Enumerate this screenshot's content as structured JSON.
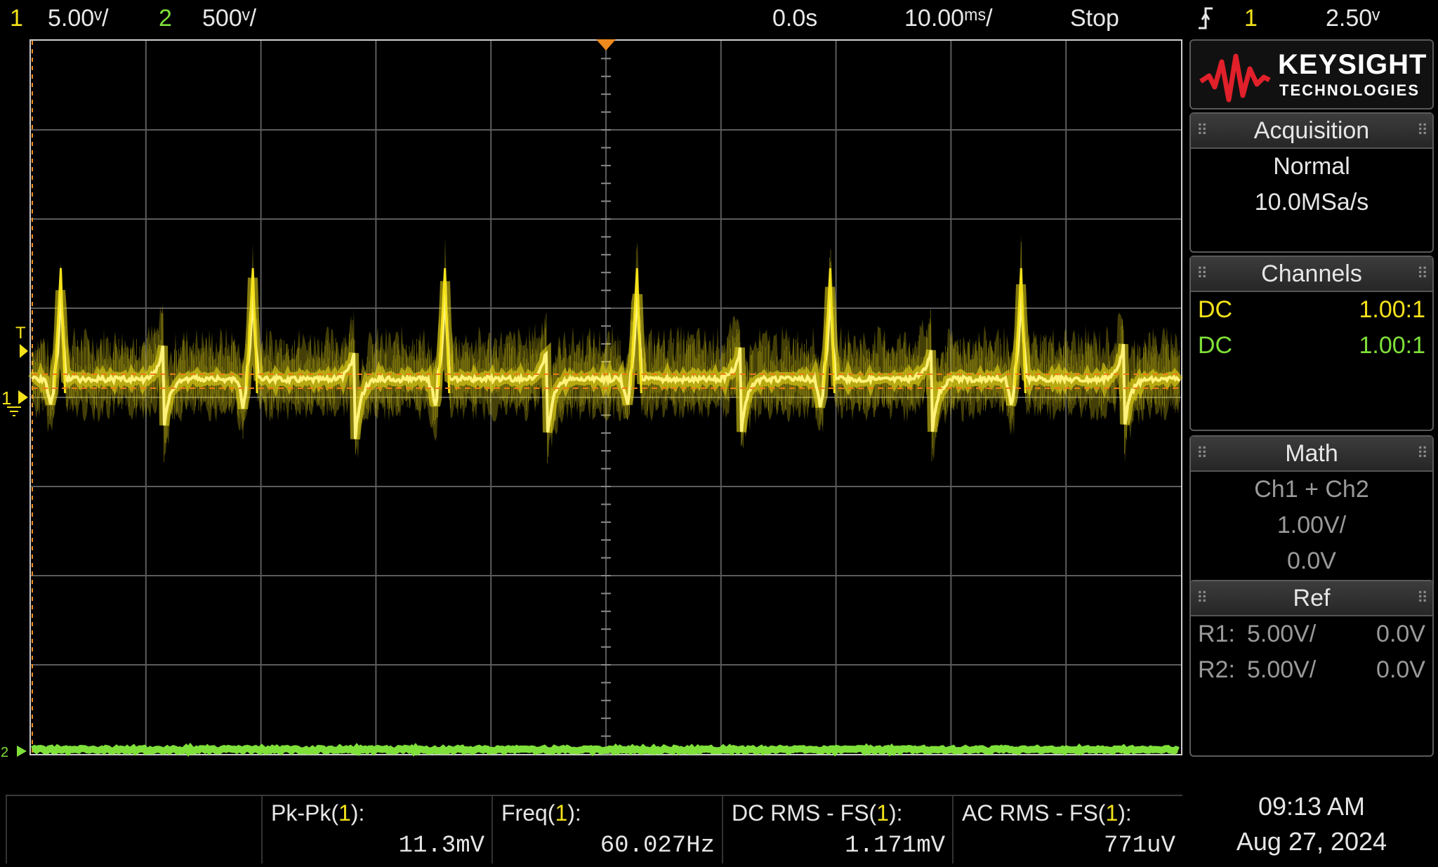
{
  "top_bar": {
    "ch1_number": "1",
    "ch1_scale": "5.00ᵛ/",
    "ch2_number": "2",
    "ch2_scale": "500ᵛ/",
    "time_delay": "0.0s",
    "time_scale": "10.00ᵐˢ/",
    "run_state": "Stop",
    "trigger_channel": "1",
    "trigger_level": "2.50ᵛ"
  },
  "plot_markers": {
    "trigger_marker": "T",
    "ch1_marker": "1",
    "ch2_marker": "2"
  },
  "logo": {
    "brand": "KEYSIGHT",
    "sub": "TECHNOLOGIES"
  },
  "acquisition": {
    "title": "Acquisition",
    "mode": "Normal",
    "rate": "10.0MSa/s"
  },
  "channels": {
    "title": "Channels",
    "items": [
      {
        "coupling": "DC",
        "probe": "1.00:1"
      },
      {
        "coupling": "DC",
        "probe": "1.00:1"
      }
    ]
  },
  "math": {
    "title": "Math",
    "expr": "Ch1 + Ch2",
    "scale": "1.00V/",
    "offset": "0.0V"
  },
  "ref": {
    "title": "Ref",
    "items": [
      {
        "name": "R1:",
        "scale": "5.00V/",
        "offset": "0.0V"
      },
      {
        "name": "R2:",
        "scale": "5.00V/",
        "offset": "0.0V"
      }
    ]
  },
  "measurements": [
    {
      "label_pre": "Pk-Pk(",
      "label_ch": "1",
      "label_post": "):",
      "value": "11.3mV"
    },
    {
      "label_pre": "Freq(",
      "label_ch": "1",
      "label_post": "):",
      "value": "60.027Hz"
    },
    {
      "label_pre": "DC RMS - FS(",
      "label_ch": "1",
      "label_post": "):",
      "value": "1.171mV"
    },
    {
      "label_pre": "AC RMS - FS(",
      "label_ch": "1",
      "label_post": "):",
      "value": "771uV"
    }
  ],
  "clock": {
    "time": "09:13 AM",
    "date": "Aug 27, 2024"
  },
  "colors": {
    "ch1": "#f4e21a",
    "ch2": "#7fe03a",
    "trigger_marker": "#f08a1e",
    "grid": "#5c5c5c"
  },
  "chart_data": {
    "type": "line",
    "x_unit": "s",
    "time_per_div": 0.01,
    "time_span": [
      -0.05,
      0.05
    ],
    "trigger_time": 0.0,
    "series": [
      {
        "name": "1",
        "color": "#f4e21a",
        "volts_per_div": 5.0,
        "signal_frequency_hz": 60.027,
        "peak_to_peak_v": 0.0113,
        "dc_rms_v": 0.001171,
        "ac_rms_v": 0.000771,
        "positive_spike_times": [
          -0.0474,
          -0.0307,
          -0.014,
          0.0027,
          0.0195,
          0.0361
        ],
        "negative_spike_times": [
          -0.0385,
          -0.0218,
          -0.0051,
          0.0117,
          0.0283,
          0.045
        ]
      },
      {
        "name": "2",
        "color": "#7fe03a",
        "volts_per_div": 0.5
      }
    ]
  }
}
